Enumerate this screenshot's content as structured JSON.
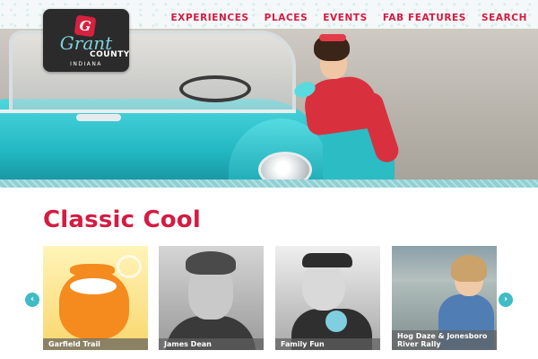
{
  "nav": {
    "items": [
      {
        "label": "EXPERIENCES"
      },
      {
        "label": "PLACES"
      },
      {
        "label": "EVENTS"
      },
      {
        "label": "FAB FEATURES"
      },
      {
        "label": "SEARCH"
      }
    ]
  },
  "logo": {
    "mark": "G",
    "line1": "Grant",
    "line2": "COUNTY",
    "line3": "INDIANA"
  },
  "section": {
    "title": "Classic Cool"
  },
  "carousel": {
    "prev_icon": "‹",
    "next_icon": "›",
    "items": [
      {
        "caption": "Garfield Trail"
      },
      {
        "caption": "James Dean"
      },
      {
        "caption": "Family Fun"
      },
      {
        "caption": "Hog Daze & Jonesboro River Rally"
      }
    ]
  },
  "colors": {
    "brand_red": "#d31c43",
    "accent_teal": "#3fbcc6",
    "logo_bg": "#2b2b2b"
  }
}
